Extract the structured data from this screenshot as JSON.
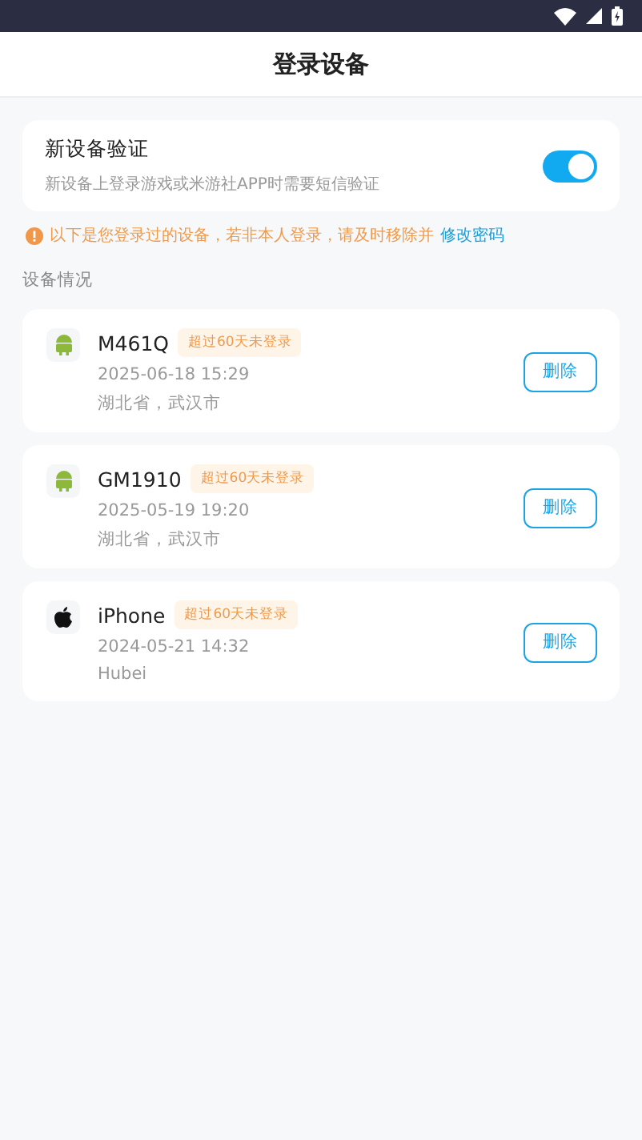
{
  "header": {
    "title": "登录设备"
  },
  "verification": {
    "title": "新设备验证",
    "description": "新设备上登录游戏或米游社APP时需要短信验证",
    "on": true
  },
  "notice": {
    "text": "以下是您登录过的设备，若非本人登录，请及时移除并",
    "link": "修改密码"
  },
  "section_label": "设备情况",
  "devices": [
    {
      "kind": "android",
      "name": "M461Q",
      "tag": "超过60天未登录",
      "time": "2025-06-18 15:29",
      "location": "湖北省，武汉市",
      "button": "删除"
    },
    {
      "kind": "android",
      "name": "GM1910",
      "tag": "超过60天未登录",
      "time": "2025-05-19 19:20",
      "location": "湖北省，武汉市",
      "button": "删除"
    },
    {
      "kind": "apple",
      "name": "iPhone",
      "tag": "超过60天未登录",
      "time": "2024-05-21 14:32",
      "location": "Hubei",
      "button": "删除"
    }
  ]
}
